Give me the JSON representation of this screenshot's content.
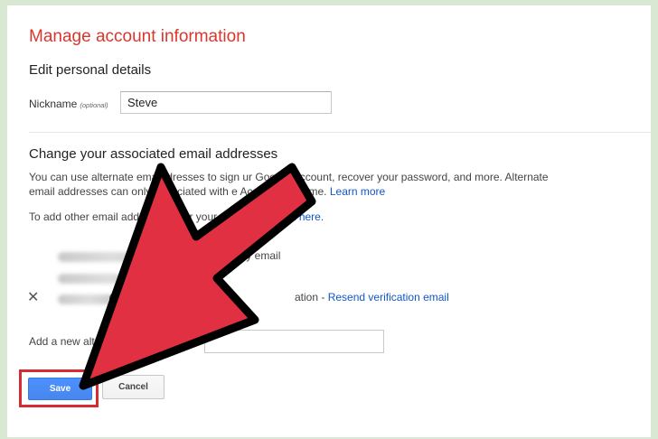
{
  "page": {
    "title": "Manage account information"
  },
  "personal": {
    "heading": "Edit personal details",
    "nickname_label": "Nickname",
    "nickname_optional": "(optional)",
    "nickname_value": "Steve"
  },
  "emails": {
    "heading": "Change your associated email addresses",
    "desc_line_1": "You can use alternate ema   ddresses to sign      ur Google Account, recover your password, and more. Alternate",
    "desc_line_2_prefix": "email addresses can only      associated with          e Account at a time.",
    "learn_more": "Learn more",
    "add_other_prefix": "To add other email addr          can          cover your password,",
    "click_here": "Click here.",
    "primary_note": "nary email",
    "at_symbol": "@",
    "verify_status": "ation -",
    "resend_link": "Resend verification email",
    "remove_icon": "✕",
    "add_alt_label": "Add a new alte",
    "add_alt_value": ""
  },
  "actions": {
    "save_label": "Save",
    "cancel_label": "Cancel"
  },
  "colors": {
    "title": "#d9372e",
    "link": "#1155cc",
    "save_button": "#4d90fe",
    "arrow_fill": "#e03042",
    "arrow_stroke": "#000000",
    "highlight_box": "#d62b33"
  }
}
